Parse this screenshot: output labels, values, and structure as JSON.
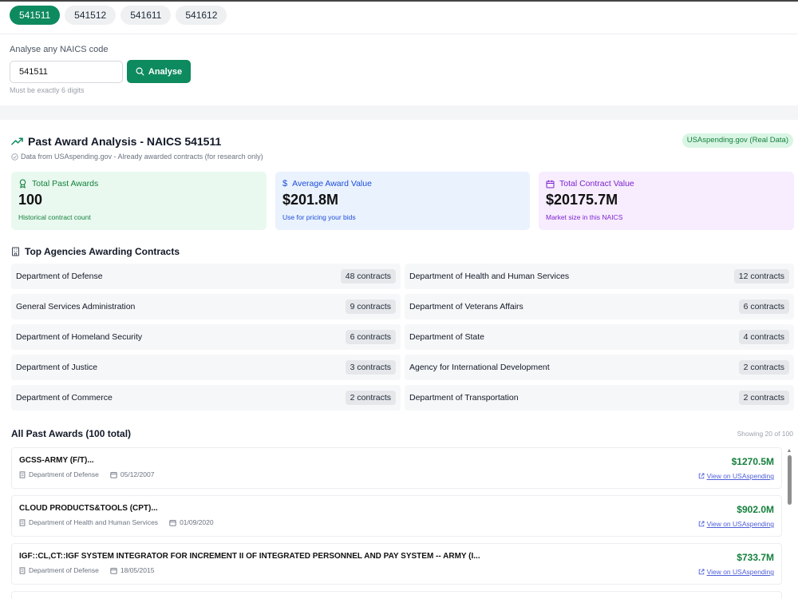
{
  "naics_chips": [
    {
      "label": "541511",
      "active": true
    },
    {
      "label": "541512",
      "active": false
    },
    {
      "label": "541611",
      "active": false
    },
    {
      "label": "541612",
      "active": false
    }
  ],
  "analyse": {
    "label": "Analyse any NAICS code",
    "input_value": "541511",
    "button_label": "Analyse",
    "hint": "Must be exactly 6 digits"
  },
  "past_awards": {
    "title": "Past Award Analysis - NAICS 541511",
    "subtitle": "Data from USAspending.gov - Already awarded contracts (for research only)",
    "source_badge": "USAspending.gov (Real Data)"
  },
  "stats": {
    "total": {
      "label": "Total Past Awards",
      "value": "100",
      "footnote": "Historical contract count"
    },
    "average": {
      "label": "Average Award Value",
      "value": "$201.8M",
      "footnote": "Use for pricing your bids"
    },
    "contract_value": {
      "label": "Total Contract Value",
      "value": "$20175.7M",
      "footnote": "Market size in this NAICS"
    }
  },
  "agencies": {
    "title": "Top Agencies Awarding Contracts",
    "items": [
      {
        "name": "Department of Defense",
        "count": "48 contracts"
      },
      {
        "name": "Department of Health and Human Services",
        "count": "12 contracts"
      },
      {
        "name": "General Services Administration",
        "count": "9 contracts"
      },
      {
        "name": "Department of Veterans Affairs",
        "count": "6 contracts"
      },
      {
        "name": "Department of Homeland Security",
        "count": "6 contracts"
      },
      {
        "name": "Department of State",
        "count": "4 contracts"
      },
      {
        "name": "Department of Justice",
        "count": "3 contracts"
      },
      {
        "name": "Agency for International Development",
        "count": "2 contracts"
      },
      {
        "name": "Department of Commerce",
        "count": "2 contracts"
      },
      {
        "name": "Department of Transportation",
        "count": "2 contracts"
      }
    ]
  },
  "all_awards": {
    "title": "All Past Awards (100 total)",
    "showing": "Showing 20 of 100",
    "link_label": "View on USAspending",
    "items": [
      {
        "title": "GCSS-ARMY (F/T)...",
        "agency": "Department of Defense",
        "date": "05/12/2007",
        "amount": "$1270.5M"
      },
      {
        "title": "CLOUD PRODUCTS&TOOLS (CPT)...",
        "agency": "Department of Health and Human Services",
        "date": "01/09/2020",
        "amount": "$902.0M"
      },
      {
        "title": "IGF::CL,CT::IGF SYSTEM INTEGRATOR FOR INCREMENT II OF INTEGRATED PERSONNEL AND PAY SYSTEM -- ARMY (I...",
        "agency": "Department of Defense",
        "date": "18/05/2015",
        "amount": "$733.7M"
      }
    ]
  },
  "colors": {
    "brand_green": "#0e8a5f",
    "amount_green": "#15803d",
    "link_blue": "#4f5fd9"
  }
}
